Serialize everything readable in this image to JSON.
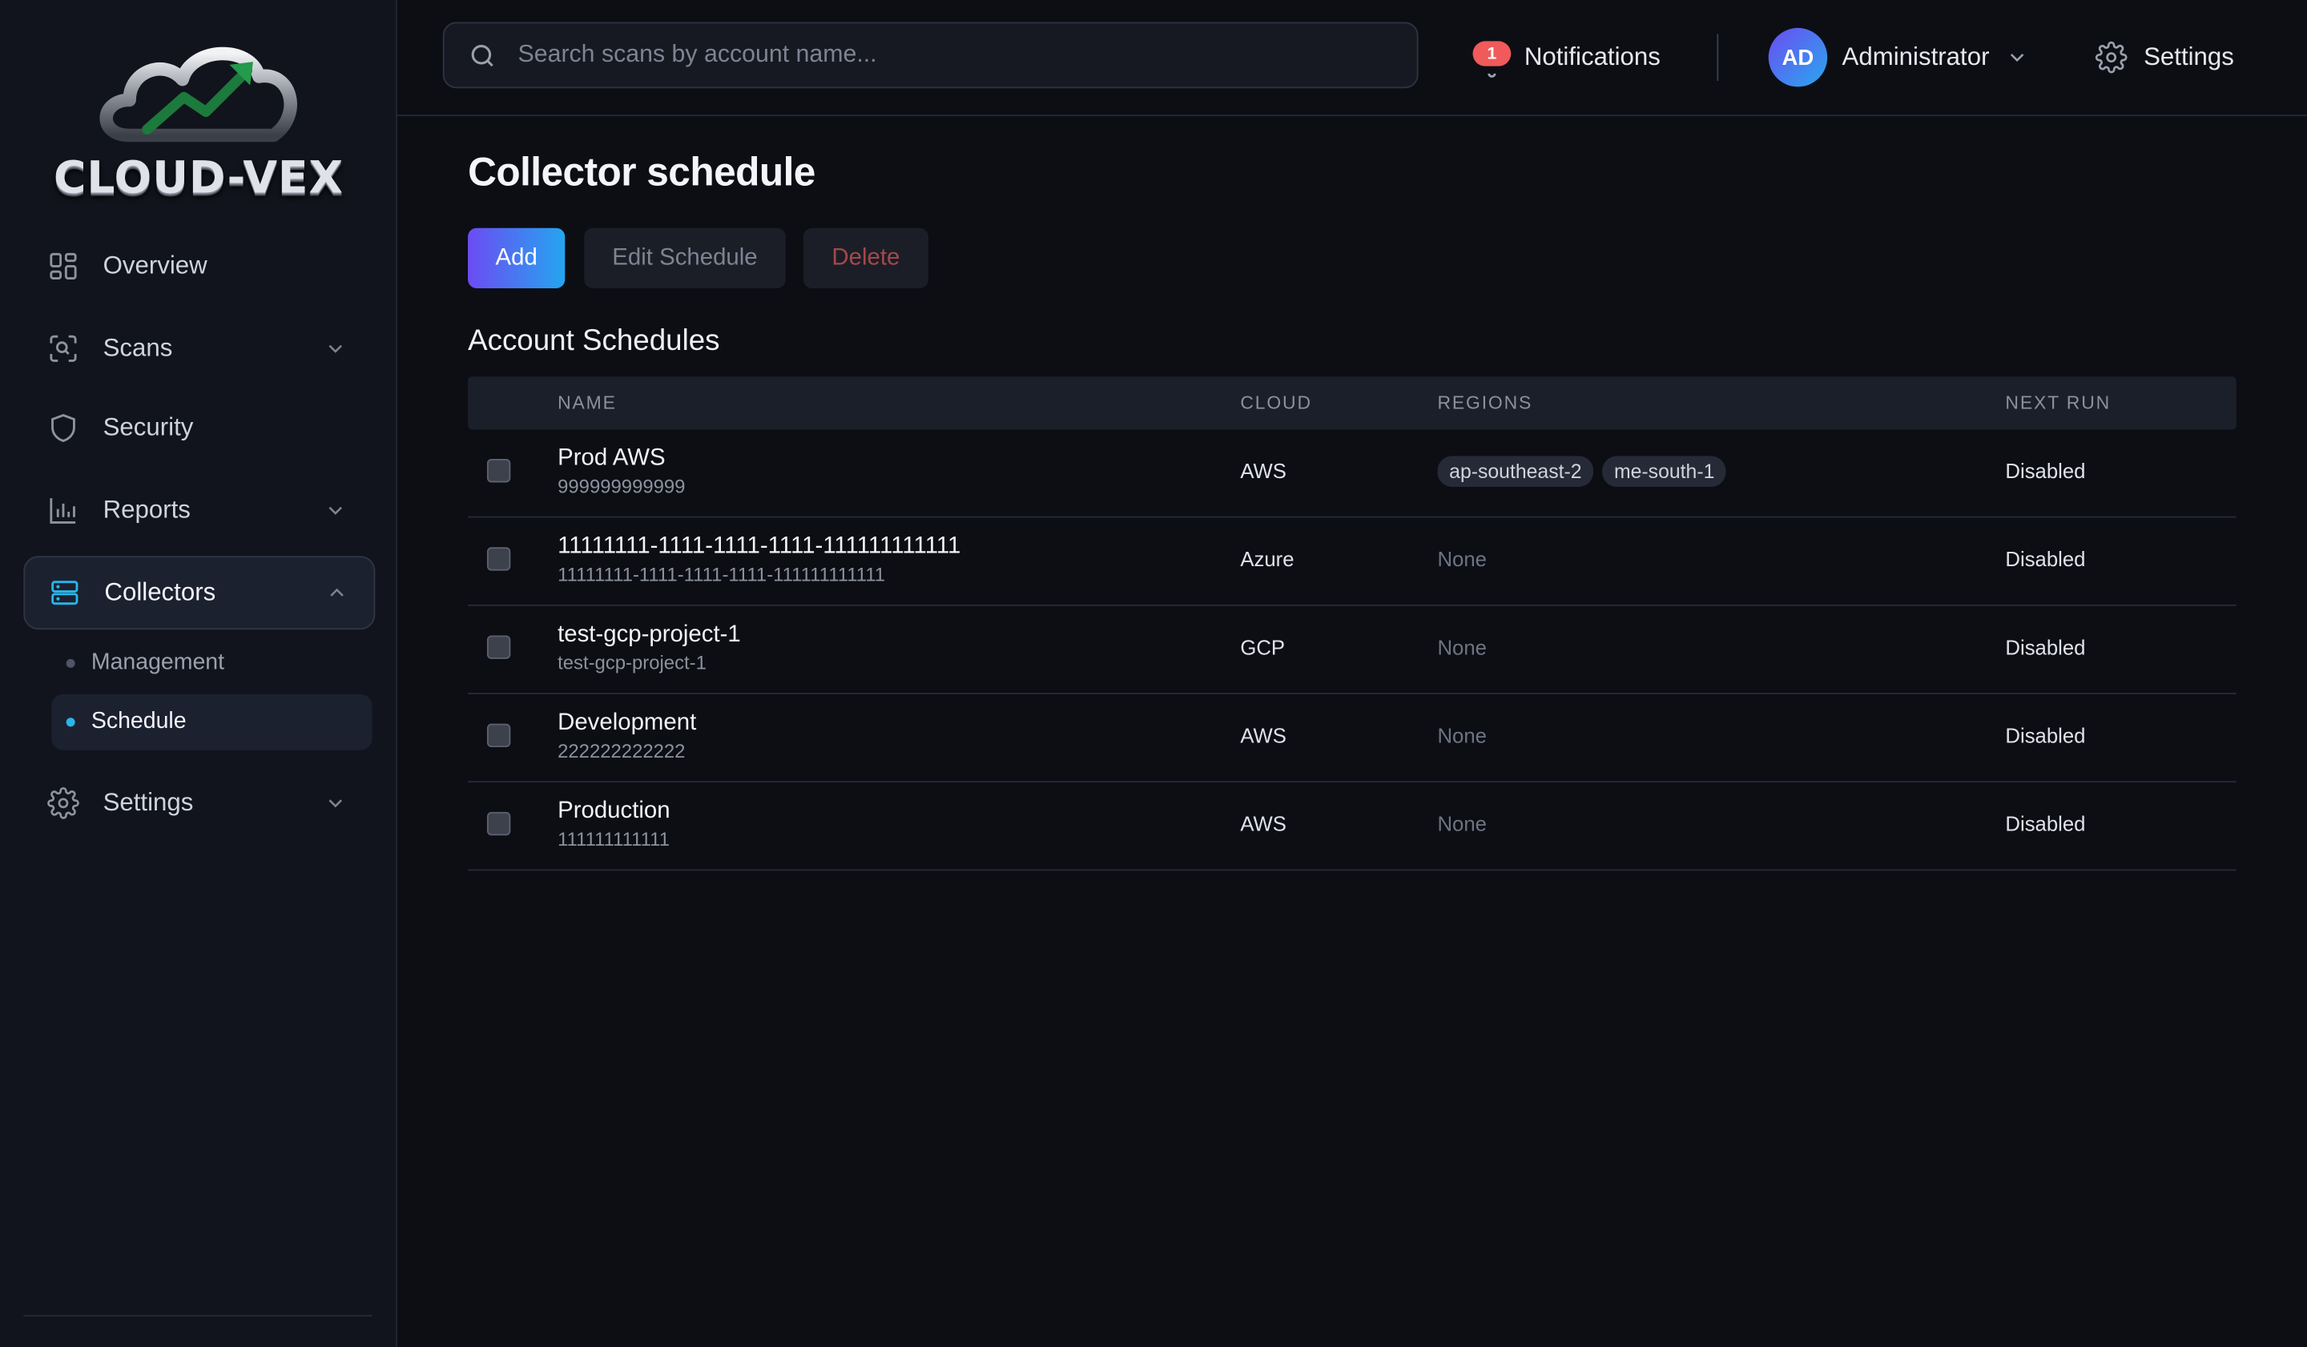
{
  "brand": {
    "name": "CLOUD-VEX"
  },
  "sidebar": {
    "items": [
      {
        "label": "Overview",
        "icon": "grid-icon"
      },
      {
        "label": "Scans",
        "icon": "scan-icon"
      },
      {
        "label": "Security",
        "icon": "shield-icon"
      },
      {
        "label": "Reports",
        "icon": "bar-chart-icon"
      },
      {
        "label": "Collectors",
        "icon": "server-icon"
      },
      {
        "label": "Settings",
        "icon": "gear-icon"
      }
    ],
    "sub_items": [
      {
        "label": "Management"
      },
      {
        "label": "Schedule"
      }
    ]
  },
  "header": {
    "search_placeholder": "Search scans by account name...",
    "notifications": {
      "label": "Notifications",
      "count": "1"
    },
    "user": {
      "initials": "AD",
      "name": "Administrator"
    },
    "settings_label": "Settings"
  },
  "page": {
    "title": "Collector schedule",
    "buttons": {
      "add": "Add",
      "edit": "Edit Schedule",
      "delete": "Delete"
    },
    "section_title": "Account Schedules"
  },
  "table": {
    "columns": [
      "NAME",
      "CLOUD",
      "REGIONS",
      "NEXT RUN"
    ],
    "rows": [
      {
        "name": "Prod AWS",
        "id": "999999999999",
        "cloud": "AWS",
        "regions": [
          "ap-southeast-2",
          "me-south-1"
        ],
        "regions_text": "",
        "next_run": "Disabled"
      },
      {
        "name": "11111111-1111-1111-1111-111111111111",
        "id": "11111111-1111-1111-1111-111111111111",
        "cloud": "Azure",
        "regions": [],
        "regions_text": "None",
        "next_run": "Disabled"
      },
      {
        "name": "test-gcp-project-1",
        "id": "test-gcp-project-1",
        "cloud": "GCP",
        "regions": [],
        "regions_text": "None",
        "next_run": "Disabled"
      },
      {
        "name": "Development",
        "id": "222222222222",
        "cloud": "AWS",
        "regions": [],
        "regions_text": "None",
        "next_run": "Disabled"
      },
      {
        "name": "Production",
        "id": "111111111111",
        "cloud": "AWS",
        "regions": [],
        "regions_text": "None",
        "next_run": "Disabled"
      }
    ]
  },
  "colors": {
    "accent_start": "#6b4cf2",
    "accent_end": "#25a5f0",
    "active_dot": "#29b6e8",
    "badge": "#f05a5a",
    "danger_text": "#a3484c"
  }
}
